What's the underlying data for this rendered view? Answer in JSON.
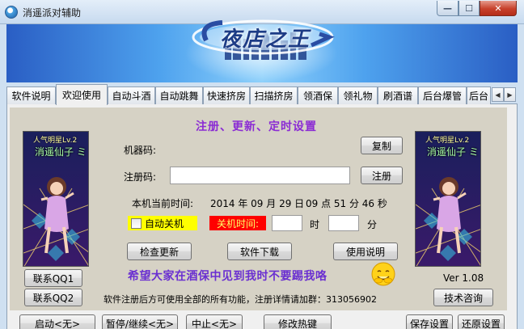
{
  "window": {
    "title": "消遥派对辅助",
    "minimize_glyph": "—",
    "maximize_glyph": "☐",
    "close_glyph": "✕"
  },
  "banner": {
    "logo_text": "夜店之王"
  },
  "tabs": [
    {
      "label": "软件说明",
      "active": false
    },
    {
      "label": "欢迎使用",
      "active": true
    },
    {
      "label": "自动斗酒",
      "active": false
    },
    {
      "label": "自动跳舞",
      "active": false
    },
    {
      "label": "快速挤房",
      "active": false
    },
    {
      "label": "扫描挤房",
      "active": false
    },
    {
      "label": "领酒保",
      "active": false
    },
    {
      "label": "领礼物",
      "active": false
    },
    {
      "label": "刷酒谱",
      "active": false
    },
    {
      "label": "后台爆管",
      "active": false
    },
    {
      "label": "后台",
      "active": false
    }
  ],
  "tab_scroll": {
    "left": "◀",
    "right": "▶"
  },
  "registration": {
    "heading": "注册、更新、定时设置",
    "machine_code_label": "机器码:",
    "machine_code_value": "",
    "copy_button": "复制",
    "reg_code_label": "注册码:",
    "reg_code_value": "",
    "register_button": "注册",
    "current_time_label": "本机当前时间:",
    "current_date": "2014 年 09 月 29 日",
    "current_time": "09 点 51 分 46 秒",
    "auto_shutdown_label": "自动关机",
    "auto_shutdown_checked": false,
    "shutdown_time_label": "关机时间:",
    "hour_value": "",
    "hour_unit": "时",
    "minute_value": "",
    "minute_unit": "分",
    "check_update_button": "检查更新",
    "download_button": "软件下载",
    "manual_button": "使用说明",
    "slogan": "希望大家在酒保中见到我时不要踢我咯",
    "info_text": "软件注册后方可使用全部的所有功能，注册详情请加群：313056902"
  },
  "avatar": {
    "title": "人气明星Lv.2",
    "name": "消遥仙子 ミ"
  },
  "side": {
    "qq1_button": "联系QQ1",
    "qq2_button": "联系QQ2",
    "version": "Ver 1.08",
    "support_button": "技术咨询"
  },
  "bottom": {
    "start_button": "启动<无>",
    "pause_button": "暂停/继续<无>",
    "stop_button": "中止<无>",
    "hotkey_button": "修改热键",
    "save_button": "保存设置",
    "restore_button": "还原设置"
  }
}
